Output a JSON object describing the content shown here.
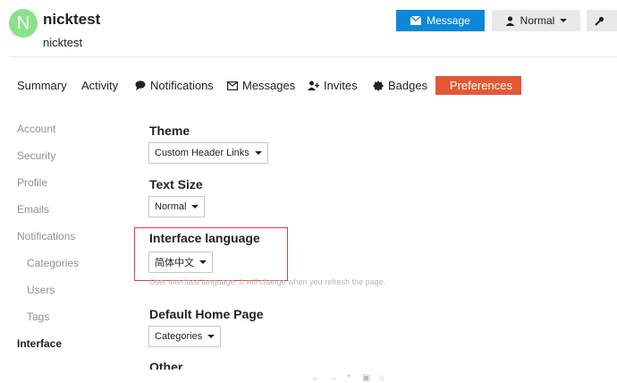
{
  "user": {
    "avatar_letter": "N",
    "username": "nicktest",
    "full_name": "nicktest"
  },
  "header_buttons": {
    "message": "Message",
    "notification_level": "Normal"
  },
  "nav": {
    "summary": "Summary",
    "activity": "Activity",
    "notifications": "Notifications",
    "messages": "Messages",
    "invites": "Invites",
    "badges": "Badges",
    "preferences": "Preferences"
  },
  "sidebar": {
    "account": "Account",
    "security": "Security",
    "profile": "Profile",
    "emails": "Emails",
    "notifications": "Notifications",
    "categories": "Categories",
    "users": "Users",
    "tags": "Tags",
    "interface": "Interface"
  },
  "prefs": {
    "theme_label": "Theme",
    "theme_value": "Custom Header Links",
    "text_size_label": "Text Size",
    "text_size_value": "Normal",
    "language_label": "Interface language",
    "language_value": "简体中文",
    "language_hint": "User interface language. It will change when you refresh the page.",
    "home_label": "Default Home Page",
    "home_value": "Categories",
    "other_label": "Other"
  },
  "colors": {
    "accent": "#e45735",
    "primary_button": "#0b88d8",
    "avatar": "#8be28b",
    "highlight_box": "#e53b3b"
  }
}
